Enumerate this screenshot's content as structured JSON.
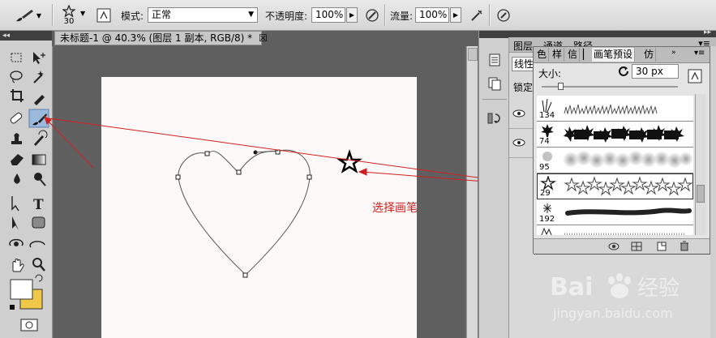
{
  "options_bar": {
    "brush_size": "30",
    "mode_label": "模式:",
    "mode_value": "正常",
    "opacity_label": "不透明度:",
    "opacity_value": "100%",
    "flow_label": "流量:",
    "flow_value": "100%"
  },
  "document": {
    "tab_title": "未标题-1 @ 40.3% (图层 1 副本, RGB/8) *",
    "close_glyph": "☒"
  },
  "layers_panel": {
    "tabs": [
      "图层",
      "通道",
      "路径"
    ],
    "blend_fragment": "线性",
    "lock_fragment": "锁定"
  },
  "brush_presets": {
    "tabs": [
      "色",
      "样",
      "信",
      "画笔预设",
      "仿"
    ],
    "size_label": "大小:",
    "size_value": "30 px",
    "brushes": [
      {
        "number": "134",
        "kind": "grass"
      },
      {
        "number": "74",
        "kind": "maple-leaf"
      },
      {
        "number": "95",
        "kind": "soft-round"
      },
      {
        "number": "29",
        "kind": "star"
      },
      {
        "number": "192",
        "kind": "dune-grass"
      }
    ]
  },
  "annotation": {
    "label": "选择画笔",
    "color": "#d22020"
  },
  "watermark": {
    "brand": "Bai 经验",
    "url": "jingyan.baidu.com"
  }
}
